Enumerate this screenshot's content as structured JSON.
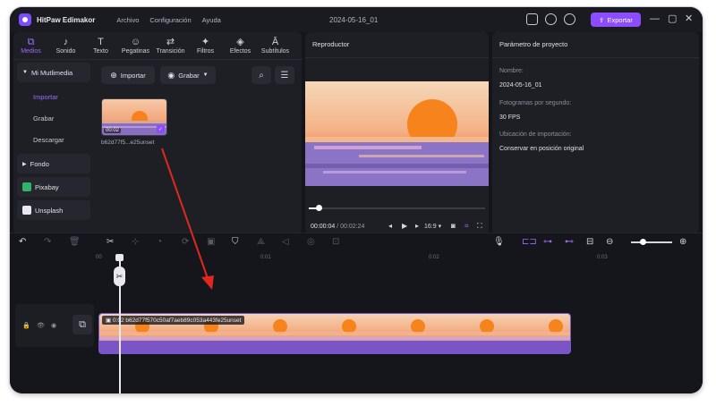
{
  "app": {
    "name": "HitPaw Edimakor",
    "doc_title": "2024-05-16_01"
  },
  "menu": [
    "Archivo",
    "Configuración",
    "Ayuda"
  ],
  "export_label": "Exportar",
  "tabs": [
    {
      "label": "Medios",
      "icon": "media-icon"
    },
    {
      "label": "Sonido",
      "icon": "music-note-icon"
    },
    {
      "label": "Texto",
      "icon": "text-icon"
    },
    {
      "label": "Pegatinas",
      "icon": "sticker-icon"
    },
    {
      "label": "Transición",
      "icon": "transition-icon"
    },
    {
      "label": "Filtros",
      "icon": "filter-icon"
    },
    {
      "label": "Efectos",
      "icon": "effects-icon"
    },
    {
      "label": "Subtítulos",
      "icon": "subtitles-icon"
    }
  ],
  "sidebar": {
    "group_label": "Mi Mutlimedia",
    "items": [
      "Importar",
      "Grabar",
      "Descargar"
    ],
    "groups": [
      "Fondo",
      "Pixabay",
      "Unsplash"
    ]
  },
  "media": {
    "import_label": "Importar",
    "record_label": "Grabar",
    "thumb_duration": "00:02",
    "thumb_name": "b62d77f5...e25unset"
  },
  "player": {
    "title": "Reproductor",
    "current_time": "00:00:04",
    "total_time": "/ 00:02:24",
    "ratio": "16:9"
  },
  "params": {
    "title": "Parámetro de proyecto",
    "name_label": "Nombre:",
    "name_value": "2024-05-16_01",
    "fps_label": "Fotogramas por segundo:",
    "fps_value": "30 FPS",
    "import_label": "Ubicación de importación:",
    "import_value": "Conservar en posición original"
  },
  "timeline": {
    "ruler": [
      "00",
      "0:01",
      "0:02",
      "0:03"
    ],
    "clip_label": "0:02 b62d77f570c50af7aeb89c053a443fe25unset"
  },
  "colors": {
    "accent": "#8b4dff",
    "background": "#15161b",
    "panel": "#1e1f25"
  }
}
